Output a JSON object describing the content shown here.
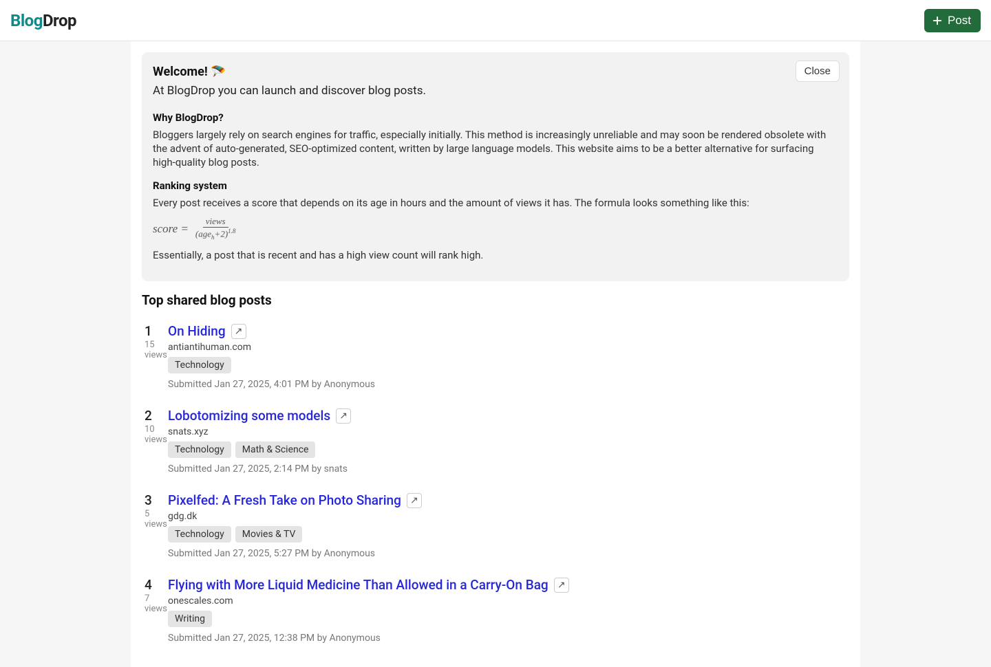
{
  "brand": {
    "part1": "Blog",
    "part2": "Drop"
  },
  "header": {
    "post_label": "Post"
  },
  "welcome": {
    "title": "Welcome! 🪂",
    "tagline": "At BlogDrop you can launch and discover blog posts.",
    "close_label": "Close",
    "why_heading": "Why BlogDrop?",
    "why_body": "Bloggers largely rely on search engines for traffic, especially initially. This method is increasingly unreliable and may soon be rendered obsolete with the advent of auto-generated, SEO-optimized content, written by large language models. This website aims to be a better alternative for surfacing high-quality blog posts.",
    "rank_heading": "Ranking system",
    "rank_body": "Every post receives a score that depends on its age in hours and the amount of views it has. The formula looks something like this:",
    "rank_tail": "Essentially, a post that is recent and has a high view count will rank high.",
    "formula": {
      "lhs": "score =",
      "num": "views",
      "den_base": "age",
      "den_sub": "h",
      "den_plus": "+2)",
      "den_exp": "1.8",
      "den_open": "("
    }
  },
  "section_title": "Top shared blog posts",
  "labels": {
    "views": "views",
    "submitted": "Submitted ",
    "by": " by "
  },
  "posts": [
    {
      "rank": "1",
      "views": "15",
      "title": "On Hiding",
      "domain": "antiantihuman.com",
      "tags": [
        "Technology"
      ],
      "date": "Jan 27, 2025, 4:01 PM",
      "author": "Anonymous"
    },
    {
      "rank": "2",
      "views": "10",
      "title": "Lobotomizing some models",
      "domain": "snats.xyz",
      "tags": [
        "Technology",
        "Math & Science"
      ],
      "date": "Jan 27, 2025, 2:14 PM",
      "author": "snats"
    },
    {
      "rank": "3",
      "views": "5",
      "title": "Pixelfed: A Fresh Take on Photo Sharing",
      "domain": "gdg.dk",
      "tags": [
        "Technology",
        "Movies & TV"
      ],
      "date": "Jan 27, 2025, 5:27 PM",
      "author": "Anonymous"
    },
    {
      "rank": "4",
      "views": "7",
      "title": "Flying with More Liquid Medicine Than Allowed in a Carry-On Bag",
      "domain": "onescales.com",
      "tags": [
        "Writing"
      ],
      "date": "Jan 27, 2025, 12:38 PM",
      "author": "Anonymous"
    }
  ]
}
